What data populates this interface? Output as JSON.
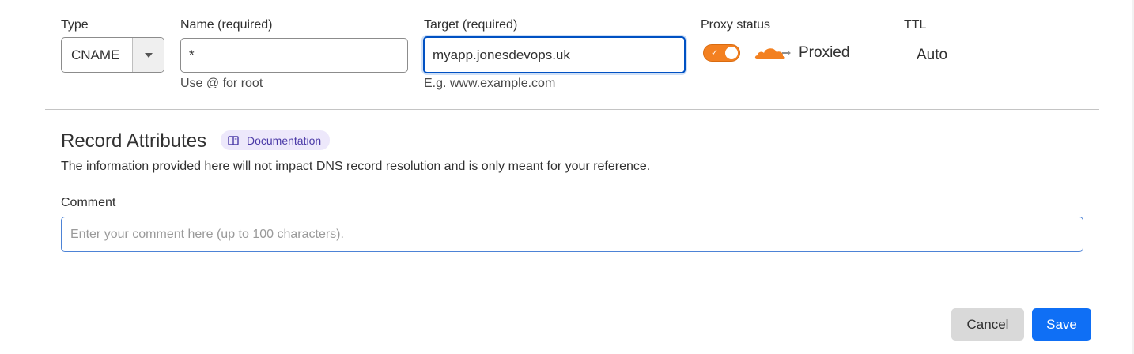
{
  "fields": {
    "type_label": "Type",
    "type_value": "CNAME",
    "name_label": "Name (required)",
    "name_value": "*",
    "name_hint": "Use @ for root",
    "target_label": "Target (required)",
    "target_value": "myapp.jonesdevops.uk",
    "target_hint": "E.g. www.example.com",
    "proxy_label": "Proxy status",
    "proxy_enabled": true,
    "proxy_value": "Proxied",
    "ttl_label": "TTL",
    "ttl_value": "Auto"
  },
  "attributes": {
    "title": "Record Attributes",
    "doc_link": "Documentation",
    "description": "The information provided here will not impact DNS record resolution and is only meant for your reference.",
    "comment_label": "Comment",
    "comment_placeholder": "Enter your comment here (up to 100 characters).",
    "comment_value": ""
  },
  "actions": {
    "cancel": "Cancel",
    "save": "Save"
  },
  "colors": {
    "accent": "#0f6ff5",
    "proxy_orange": "#f38020",
    "focus_border": "#0051c3",
    "doc_badge_bg": "#ede8fb"
  },
  "icons": {
    "type_dropdown": "caret-down-icon",
    "proxy_cloud": "orange-cloud-icon",
    "doc": "book-icon",
    "toggle_check": "check-icon"
  }
}
